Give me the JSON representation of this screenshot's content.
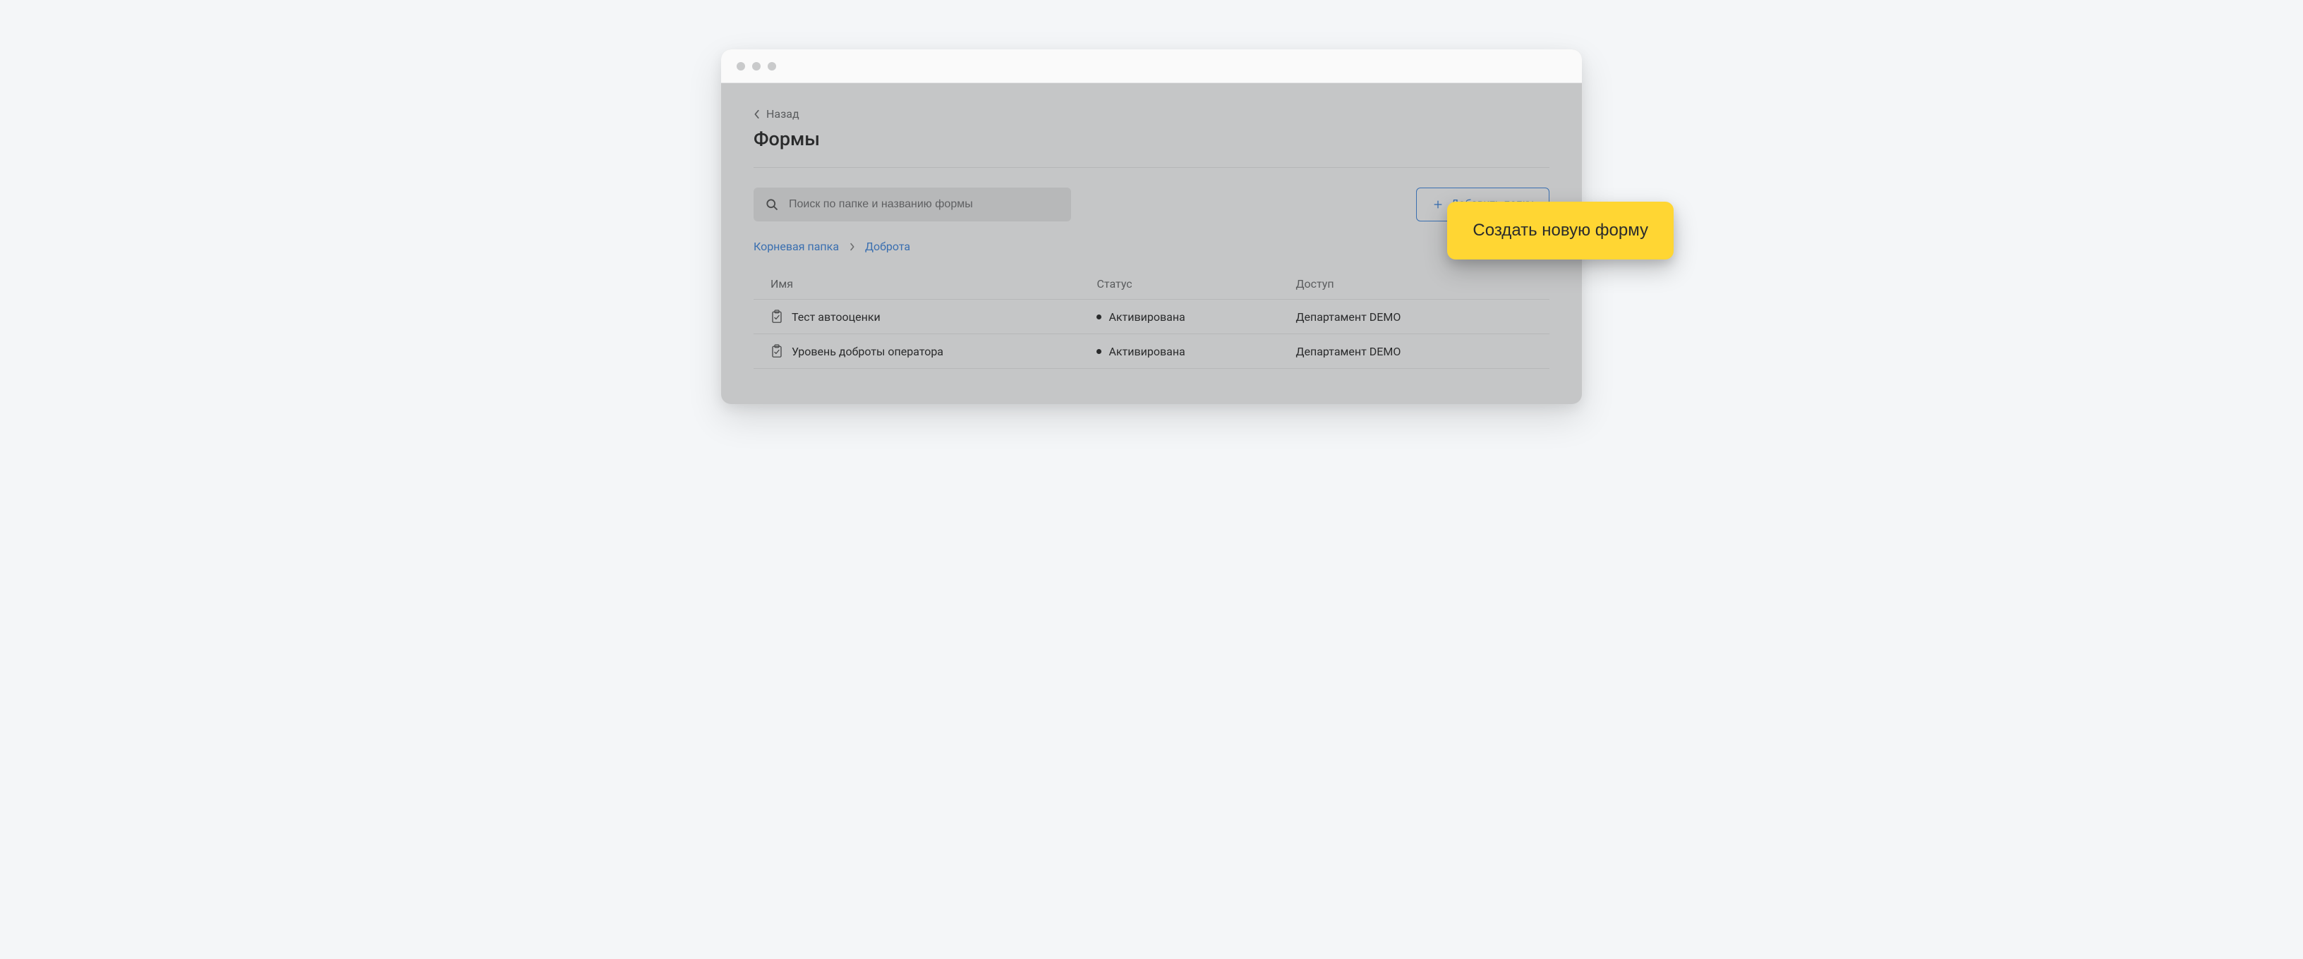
{
  "back_label": "Назад",
  "page_title": "Формы",
  "search": {
    "placeholder": "Поиск по папке и названию формы"
  },
  "buttons": {
    "add_folder": "Добавить папку",
    "create_form": "Создать новую форму"
  },
  "breadcrumb": {
    "root": "Корневая папка",
    "current": "Доброта"
  },
  "table": {
    "headers": {
      "name": "Имя",
      "status": "Статус",
      "access": "Доступ"
    },
    "rows": [
      {
        "name": "Тест автооценки",
        "status": "Активирована",
        "access": "Департамент DEMO"
      },
      {
        "name": "Уровень доброты оператора",
        "status": "Активирована",
        "access": "Департамент DEMO"
      }
    ]
  }
}
